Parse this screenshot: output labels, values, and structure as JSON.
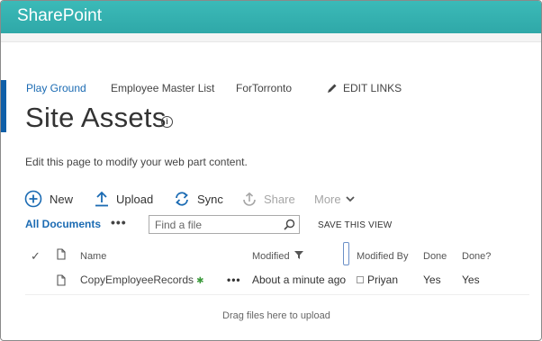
{
  "suite": {
    "brand": "SharePoint"
  },
  "topnav": {
    "items": [
      "Play Ground",
      "Employee Master List",
      "ForTorronto"
    ],
    "edit_links": "EDIT LINKS"
  },
  "page": {
    "title": "Site Assets",
    "edit_note": "Edit this page to modify your web part content."
  },
  "commands": {
    "new": "New",
    "upload": "Upload",
    "sync": "Sync",
    "share": "Share",
    "more": "More"
  },
  "view": {
    "current": "All Documents",
    "more": "•••",
    "search_placeholder": "Find a file",
    "save_view": "SAVE THIS VIEW"
  },
  "list": {
    "columns": [
      "Name",
      "Modified",
      "Modified By",
      "Done",
      "Done?"
    ],
    "rows": [
      {
        "name": "CopyEmployeeRecords",
        "modified": "About a minute ago",
        "modified_by": "Priyan",
        "done": "Yes",
        "done_q": "Yes"
      }
    ],
    "drag_hint": "Drag files here to upload"
  },
  "colors": {
    "suite": "#3cb4b4",
    "accent": "#0f5fa8",
    "link": "#1b6bb3"
  }
}
